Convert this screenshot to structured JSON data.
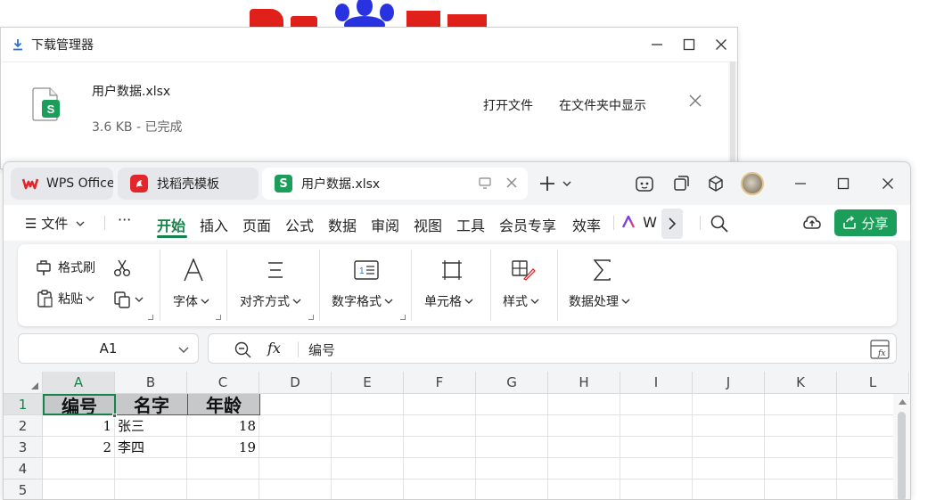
{
  "download_manager": {
    "title": "下载管理器",
    "file_name": "用户数据.xlsx",
    "status": "3.6 KB - 已完成",
    "open_file_label": "打开文件",
    "show_in_folder_label": "在文件夹中显示",
    "file_icon_letter": "S"
  },
  "wps": {
    "tabs": [
      {
        "label": "WPS Office",
        "icon": "wps-logo-icon"
      },
      {
        "label": "找稻壳模板",
        "icon": "docer-icon"
      },
      {
        "label": "用户数据.xlsx",
        "icon": "spreadsheet-icon",
        "icon_letter": "S"
      }
    ],
    "menu": {
      "file_label": "文件",
      "more_label": "···",
      "items": [
        "开始",
        "插入",
        "页面",
        "公式",
        "数据",
        "审阅",
        "视图",
        "工具",
        "会员专享",
        "效率",
        "W"
      ],
      "share_label": "分享"
    },
    "ribbon": {
      "format_painter": "格式刷",
      "paste": "粘贴",
      "font": "字体",
      "alignment": "对齐方式",
      "number_format": "数字格式",
      "cell": "单元格",
      "style": "样式",
      "data_processing": "数据处理"
    },
    "formula_bar": {
      "cell_ref": "A1",
      "fx_label": "fx",
      "value": "编号"
    },
    "grid": {
      "columns": [
        "A",
        "B",
        "C",
        "D",
        "E",
        "F",
        "G",
        "H",
        "I",
        "J",
        "K",
        "L"
      ],
      "rows": [
        "1",
        "2",
        "3",
        "4",
        "5"
      ],
      "cells": [
        [
          "编号",
          "名字",
          "年龄"
        ],
        [
          "1",
          "张三",
          "18"
        ],
        [
          "2",
          "李四",
          "19"
        ]
      ]
    }
  },
  "colors": {
    "accent_green": "#15834b",
    "share_green": "#1b9e5a",
    "wps_red": "#e3262c",
    "header_fill": "#c7c8ca"
  }
}
